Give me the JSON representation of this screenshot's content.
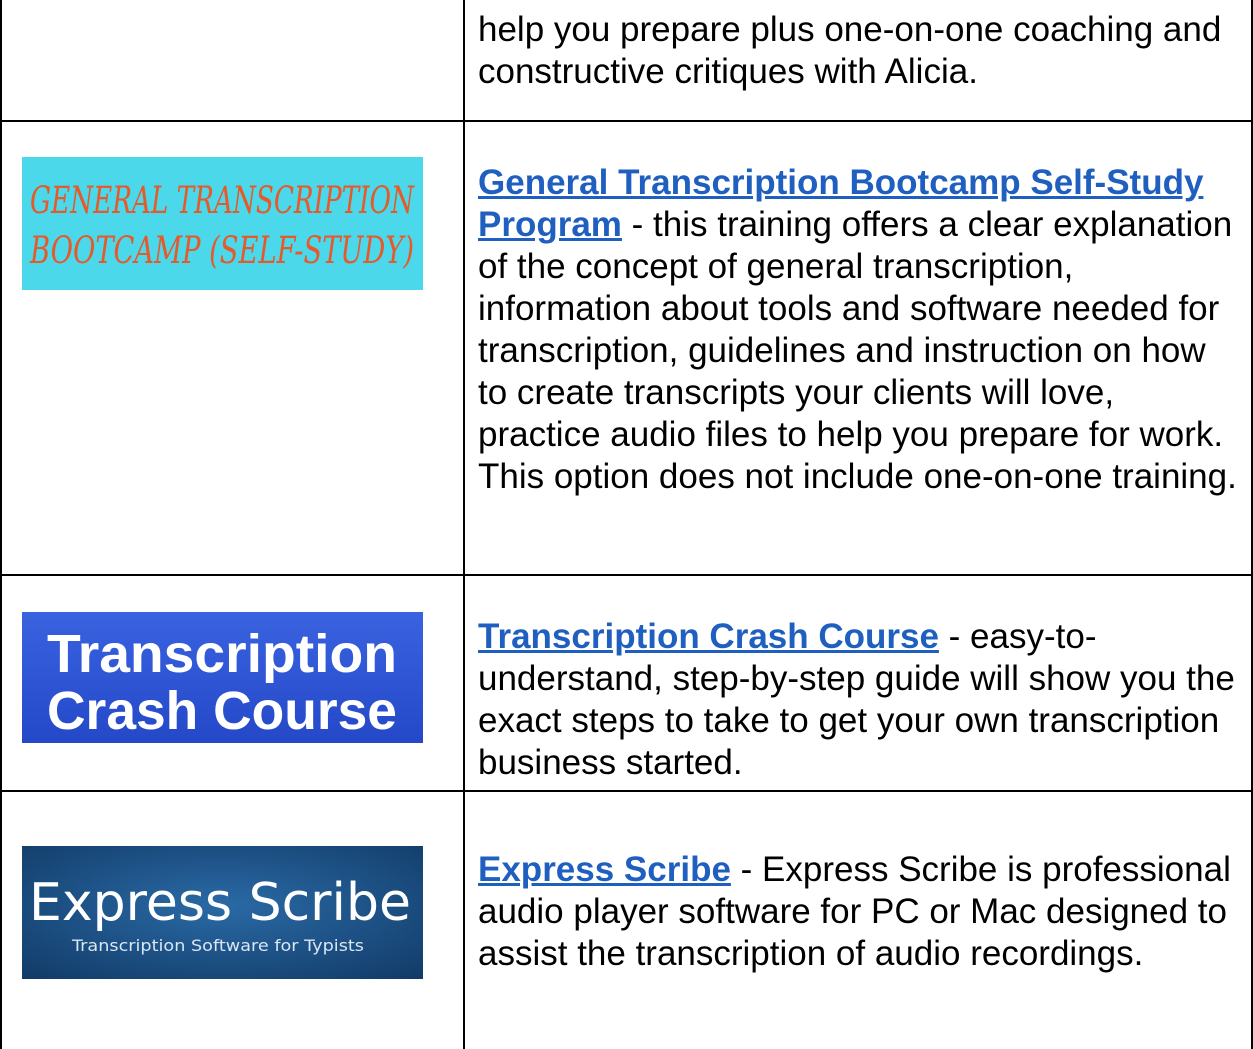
{
  "rows": [
    {
      "text": "help you prepare plus one-on-one coaching and constructive critiques with Alicia."
    },
    {
      "image": {
        "line1": "GENERAL TRANSCRIPTION",
        "line2": "BOOTCAMP (SELF-STUDY)",
        "bg": "#3fd4e8",
        "ink": "#e65a2a"
      },
      "link": "General Transcription Bootcamp Self-Study Program",
      "text": " - this training offers a clear explanation of the concept of general transcription, information about tools and software needed for transcription, guidelines and instruction on how to create transcripts your clients will love, practice audio files to help you prepare for work. This option does not include one-on-one training."
    },
    {
      "image": {
        "line1": "Transcription",
        "line2": "Crash Course",
        "bg": "#2f55d6",
        "ink": "#ffffff"
      },
      "link": "Transcription Crash Course",
      "text": " - easy-to-understand, step-by-step guide will show you the exact steps to take to get your own transcription business started."
    },
    {
      "image": {
        "line1": "Express Scribe",
        "line2": "Transcription Software for Typists",
        "bg": "#1a4d82",
        "ink": "#ffffff"
      },
      "link": "Express Scribe",
      "text": " - Express Scribe is professional audio player software for PC or Mac designed to assist the transcription of audio recordings."
    }
  ],
  "colors": {
    "link": "#1f5fbf",
    "border": "#000000"
  }
}
